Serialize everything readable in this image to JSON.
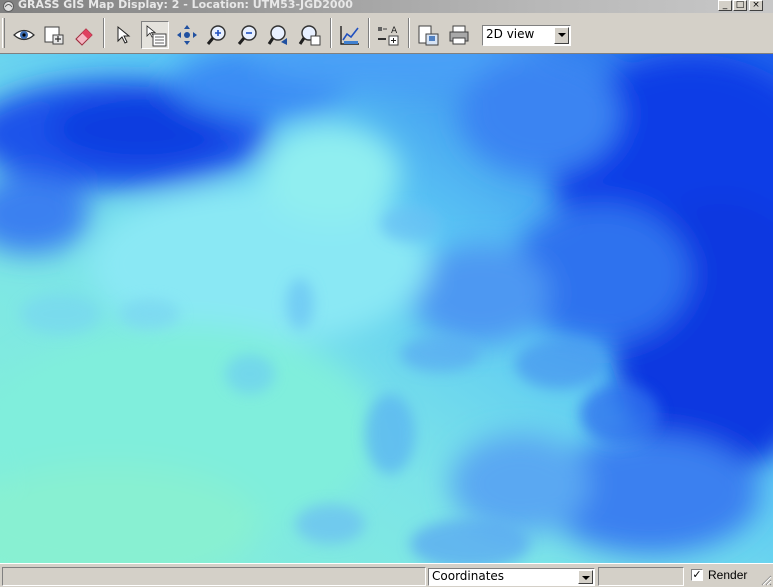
{
  "window": {
    "title": "GRASS GIS Map Display: 2 - Location: UTM53-JGD2000",
    "controls": {
      "minimize": "_",
      "maximize": "□",
      "close": "×"
    }
  },
  "toolbar": {
    "buttons": [
      {
        "name": "display-map-button",
        "icon": "eye-icon"
      },
      {
        "name": "render-map-button",
        "icon": "render-map-icon"
      },
      {
        "name": "erase-display-button",
        "icon": "eraser-icon"
      },
      {
        "name": "pointer-button",
        "icon": "pointer-icon"
      },
      {
        "name": "query-button",
        "icon": "query-icon",
        "pressed": true
      },
      {
        "name": "pan-button",
        "icon": "pan-icon"
      },
      {
        "name": "zoom-in-button",
        "icon": "zoom-in-icon"
      },
      {
        "name": "zoom-out-button",
        "icon": "zoom-out-icon"
      },
      {
        "name": "zoom-back-button",
        "icon": "zoom-back-icon"
      },
      {
        "name": "zoom-menu-button",
        "icon": "zoom-menu-icon"
      },
      {
        "name": "analyze-button",
        "icon": "analyze-icon"
      },
      {
        "name": "decorations-button",
        "icon": "decorations-icon"
      },
      {
        "name": "save-image-button",
        "icon": "save-image-icon"
      },
      {
        "name": "print-button",
        "icon": "printer-icon"
      }
    ],
    "view_select": {
      "value": "2D view"
    }
  },
  "map": {
    "description_colors": {
      "low": "#7ff0d8",
      "mid": "#6fd0ff",
      "high": "#0037e8"
    }
  },
  "statusbar": {
    "mode_select": {
      "value": "Coordinates"
    },
    "render_checkbox": {
      "label": "Render",
      "checked": true,
      "mark": "✓"
    }
  }
}
